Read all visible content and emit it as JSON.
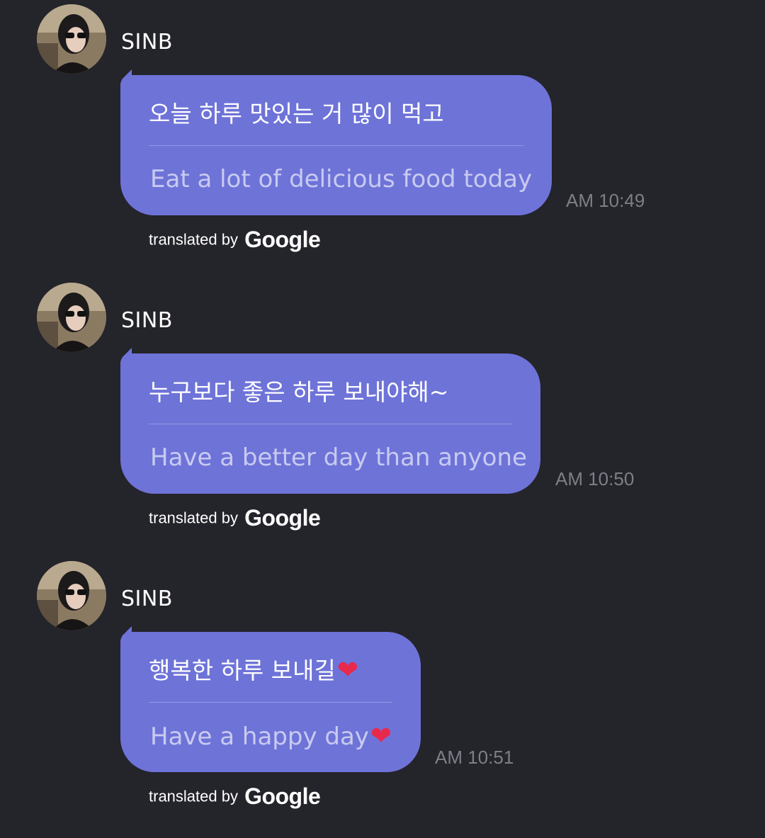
{
  "messages": [
    {
      "sender": "SINB",
      "original": "오늘 하루 맛있는 거 많이 먹고",
      "translation": "Eat a lot of delicious food today",
      "time": "AM 10:49",
      "credit_prefix": "translated by",
      "credit_brand": "Google"
    },
    {
      "sender": "SINB",
      "original": "누구보다 좋은 하루 보내야해~",
      "translation": "Have a better day than anyone",
      "time": "AM 10:50",
      "credit_prefix": "translated by",
      "credit_brand": "Google"
    },
    {
      "sender": "SINB",
      "original": "행복한 하루 보내길",
      "translation": "Have a happy day",
      "heart": "❤",
      "time": "AM 10:51",
      "credit_prefix": "translated by",
      "credit_brand": "Google"
    }
  ],
  "colors": {
    "background": "#24242b",
    "bubble": "#6e73d8",
    "heart": "#e8294b",
    "timestamp": "#7e7e87"
  }
}
